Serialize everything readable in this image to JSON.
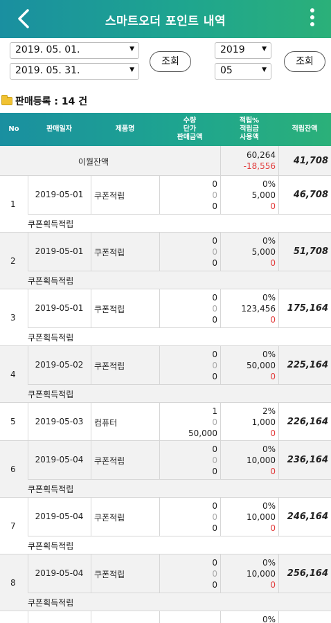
{
  "header": {
    "title": "스마트오더 포인트 내역",
    "back_icon": "chevron-left-icon",
    "menu_icon": "more-vertical-icon"
  },
  "filters": {
    "start_date": "2019. 05. 01.",
    "end_date": "2019. 05. 31.",
    "search_label_1": "조회",
    "year": "2019",
    "month": "05",
    "search_label_2": "조회",
    "dropdown_glyph": "▼"
  },
  "section": {
    "title": "판매등록 : 14 건"
  },
  "table": {
    "headers": {
      "no": "No",
      "date": "판매일자",
      "product": "제품명",
      "qty_price_amount": [
        "수량",
        "단가",
        "판매금액"
      ],
      "rate_points_used": [
        "적립%",
        "적립금",
        "사용액"
      ],
      "balance": "적립잔액"
    },
    "carryover": {
      "label": "이월잔액",
      "points": "60,264",
      "used": "-18,556",
      "balance": "41,708"
    },
    "rows": [
      {
        "no": "1",
        "date": "2019-05-01",
        "product": "쿠폰적립",
        "qty": "0",
        "price": "0",
        "amount": "0",
        "rate": "0%",
        "points": "5,000",
        "used": "0",
        "balance": "46,708",
        "note": "쿠폰획득적립"
      },
      {
        "no": "2",
        "date": "2019-05-01",
        "product": "쿠폰적립",
        "qty": "0",
        "price": "0",
        "amount": "0",
        "rate": "0%",
        "points": "5,000",
        "used": "0",
        "balance": "51,708",
        "note": "쿠폰획득적립"
      },
      {
        "no": "3",
        "date": "2019-05-01",
        "product": "쿠폰적립",
        "qty": "0",
        "price": "0",
        "amount": "0",
        "rate": "0%",
        "points": "123,456",
        "used": "0",
        "balance": "175,164",
        "note": "쿠폰획득적립"
      },
      {
        "no": "4",
        "date": "2019-05-02",
        "product": "쿠폰적립",
        "qty": "0",
        "price": "0",
        "amount": "0",
        "rate": "0%",
        "points": "50,000",
        "used": "0",
        "balance": "225,164",
        "note": "쿠폰획득적립"
      },
      {
        "no": "5",
        "date": "2019-05-03",
        "product": "컴퓨터",
        "qty": "1",
        "price": "0",
        "amount": "50,000",
        "rate": "2%",
        "points": "1,000",
        "used": "0",
        "balance": "226,164",
        "note": ""
      },
      {
        "no": "6",
        "date": "2019-05-04",
        "product": "쿠폰적립",
        "qty": "0",
        "price": "0",
        "amount": "0",
        "rate": "0%",
        "points": "10,000",
        "used": "0",
        "balance": "236,164",
        "note": "쿠폰획득적립"
      },
      {
        "no": "7",
        "date": "2019-05-04",
        "product": "쿠폰적립",
        "qty": "0",
        "price": "0",
        "amount": "0",
        "rate": "0%",
        "points": "10,000",
        "used": "0",
        "balance": "246,164",
        "note": "쿠폰획득적립"
      },
      {
        "no": "8",
        "date": "2019-05-04",
        "product": "쿠폰적립",
        "qty": "0",
        "price": "0",
        "amount": "0",
        "rate": "0%",
        "points": "10,000",
        "used": "0",
        "balance": "256,164",
        "note": "쿠폰획득적립"
      },
      {
        "no": "",
        "date": "",
        "product": "",
        "qty": "",
        "price": "",
        "amount": "",
        "rate": "0%",
        "points": "",
        "used": "",
        "balance": "",
        "note": ""
      }
    ]
  },
  "colors": {
    "header_start": "#1a8fa0",
    "header_end": "#2bb079",
    "negative": "#e23b3b",
    "row_alt": "#f2f2f2"
  }
}
